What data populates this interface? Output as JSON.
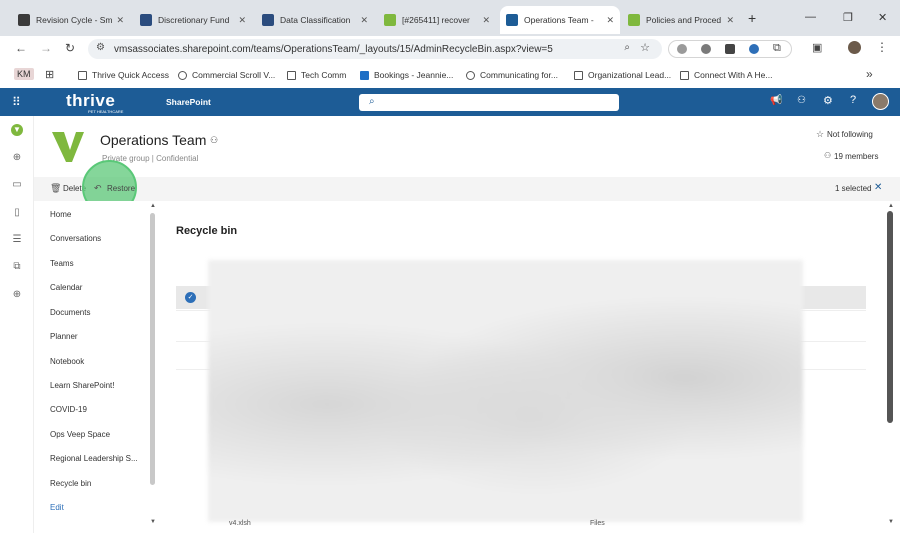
{
  "browser": {
    "tabs": [
      {
        "label": "Revision Cycle - Sm",
        "color": "#3a3a3a"
      },
      {
        "label": "Discretionary Fund",
        "color": "#2b4c7e"
      },
      {
        "label": "Data Classification",
        "color": "#2b4c7e"
      },
      {
        "label": "[#265411] recover",
        "color": "#7fb83e"
      },
      {
        "label": "Operations Team -",
        "color": "#1d5c96"
      },
      {
        "label": "Policies and Proced",
        "color": "#7fb83e"
      }
    ],
    "new_tab": "+",
    "url": "vmsassociates.sharepoint.com/teams/OperationsTeam/_layouts/15/AdminRecycleBin.aspx?view=5",
    "profile": "KM",
    "bookmarks": [
      "Thrive Quick Access",
      "Commercial Scroll V...",
      "Tech Comm",
      "Bookings - Jeannie...",
      "Communicating for...",
      "Organizational Lead...",
      "Connect With A He..."
    ],
    "more": "»"
  },
  "suite_bar": {
    "brand": "thrive",
    "brand_sub": "PET HEALTHCARE",
    "app": "SharePoint"
  },
  "site": {
    "title": "Operations Team",
    "meta": "Private group | Confidential",
    "follow": "Not following",
    "members": "19 members"
  },
  "commands": {
    "delete": "Delete",
    "restore": "Restore",
    "selected": "1 selected"
  },
  "nav": [
    "Home",
    "Conversations",
    "Teams",
    "Calendar",
    "Documents",
    "Planner",
    "Notebook",
    "Learn SharePoint!",
    "COVID-19",
    "Ops Veep Space",
    "Regional Leadership S...",
    "Recycle bin",
    "Edit"
  ],
  "main": {
    "heading": "Recycle bin",
    "bottom_file": "v4.xlsh",
    "bottom_col": "Files"
  }
}
